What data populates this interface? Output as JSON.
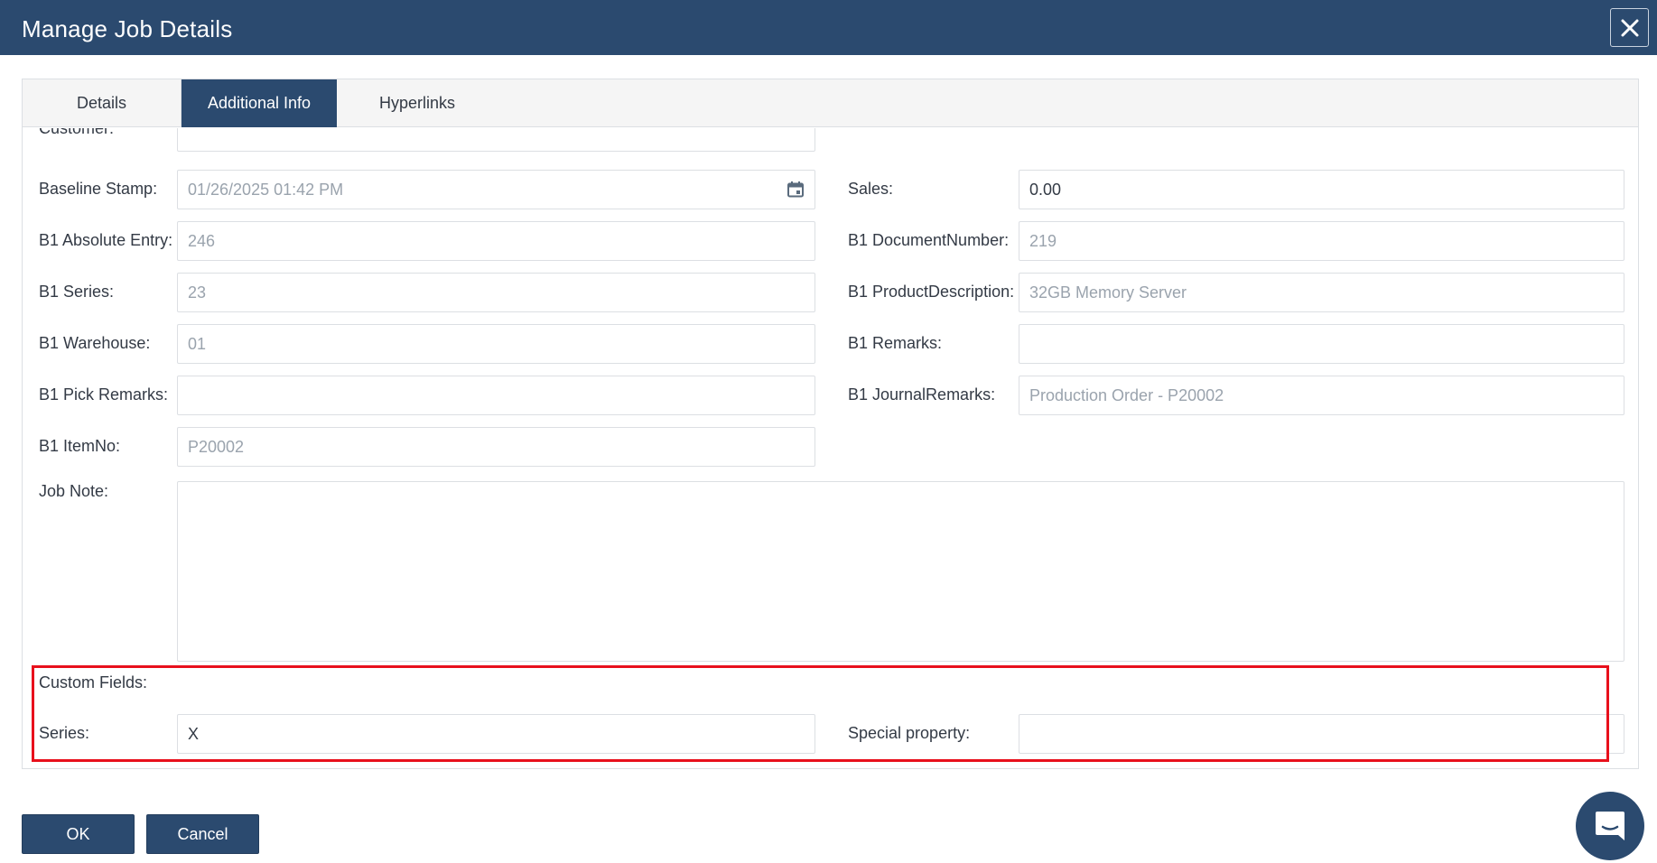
{
  "window": {
    "title": "Manage Job Details"
  },
  "tabs": [
    {
      "label": "Details"
    },
    {
      "label": "Additional Info"
    },
    {
      "label": "Hyperlinks"
    }
  ],
  "form": {
    "customer_label": "Customer:",
    "baseline_stamp": {
      "label": "Baseline Stamp:",
      "value": "01/26/2025 01:42 PM"
    },
    "sales": {
      "label": "Sales:",
      "value": "0.00"
    },
    "b1_absolute_entry": {
      "label": "B1 Absolute Entry:",
      "value": "246"
    },
    "b1_document_number": {
      "label": "B1 DocumentNumber:",
      "value": "219"
    },
    "b1_series": {
      "label": "B1 Series:",
      "value": "23"
    },
    "b1_product_description": {
      "label": "B1 ProductDescription:",
      "value": "32GB Memory Server"
    },
    "b1_warehouse": {
      "label": "B1 Warehouse:",
      "value": "01"
    },
    "b1_remarks": {
      "label": "B1 Remarks:",
      "value": ""
    },
    "b1_pick_remarks": {
      "label": "B1 Pick Remarks:",
      "value": ""
    },
    "b1_journal_remarks": {
      "label": "B1 JournalRemarks:",
      "value": "Production Order - P20002"
    },
    "b1_item_no": {
      "label": "B1 ItemNo:",
      "value": "P20002"
    },
    "job_note": {
      "label": "Job Note:",
      "value": ""
    }
  },
  "custom_fields": {
    "heading": "Custom Fields:",
    "series": {
      "label": "Series:",
      "value": "X"
    },
    "special_property": {
      "label": "Special property:",
      "value": ""
    }
  },
  "buttons": {
    "ok": "OK",
    "cancel": "Cancel"
  },
  "icons": {
    "close": "close-icon",
    "calendar": "calendar-icon",
    "chat": "chat-icon"
  },
  "colors": {
    "header": "#2b4a6f",
    "highlight": "#e8101c"
  }
}
